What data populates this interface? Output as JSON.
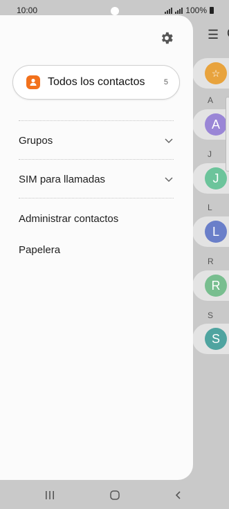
{
  "status_bar": {
    "time": "10:00",
    "battery": "100%"
  },
  "drawer": {
    "all_contacts": {
      "label": "Todos los contactos",
      "count": "5"
    },
    "menu": [
      {
        "label": "Grupos"
      },
      {
        "label": "SIM para llamadas"
      },
      {
        "label": "Administrar contactos"
      },
      {
        "label": "Papelera"
      }
    ]
  },
  "background_list": {
    "sections": [
      "A",
      "J",
      "L",
      "R",
      "S"
    ],
    "avatars": [
      {
        "letter": "A",
        "color": "#9a86d6"
      },
      {
        "letter": "J",
        "color": "#6cc49b"
      },
      {
        "letter": "L",
        "color": "#6a7fc9"
      },
      {
        "letter": "R",
        "color": "#78be8f"
      },
      {
        "letter": "S",
        "color": "#4fa4a0"
      }
    ],
    "favorites_color": "#e8a33d",
    "header_peek": "C"
  },
  "colors": {
    "accent": "#f2711c"
  }
}
